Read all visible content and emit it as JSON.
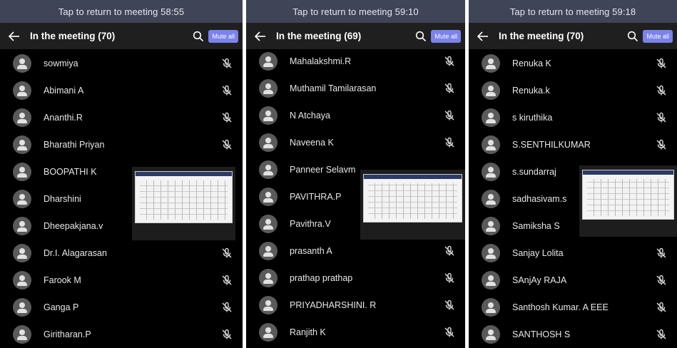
{
  "panels": [
    {
      "banner": "Tap to return to meeting 58:55",
      "title": "In the meeting (70)",
      "mute_all": "Mute all",
      "participants": [
        "sowmiya",
        "Abimani A",
        "Ananthi.R",
        "Bharathi Priyan",
        "BOOPATHI K",
        "Dharshini",
        "Dheepakjana.v",
        "Dr.I. Alagarasan",
        "Farook M",
        "Ganga P",
        "Giritharan.P"
      ]
    },
    {
      "banner": "Tap to return to meeting 59:10",
      "title": "In the meeting (69)",
      "mute_all": "Mute all",
      "participants": [
        "Mahalakshmi.R",
        "Muthamil Tamilarasan",
        "N Atchaya",
        "Naveena K",
        "Panneer Selavm",
        "PAVITHRA.P",
        "Pavithra.V",
        "prasanth A",
        "prathap prathap",
        "PRIYADHARSHINI. R",
        "Ranjith K"
      ]
    },
    {
      "banner": "Tap to return to meeting 59:18",
      "title": "In the meeting (70)",
      "mute_all": "Mute all",
      "participants": [
        "Renuka K",
        "Renuka.k",
        "s kiruthika",
        "S.SENTHILKUMAR",
        "s.sundarraj",
        "sadhasivam.s",
        "Samiksha S",
        "Sanjay Lolita",
        "SAnjAy RAJA",
        "Santhosh Kumar. A EEE",
        "SANTHOSH S"
      ]
    }
  ],
  "icons": {
    "back": "arrow-left-icon",
    "search": "search-icon",
    "mic": "mic-off-icon",
    "avatar": "person-icon"
  },
  "colors": {
    "banner_bg": "#3f4457",
    "header_bg": "#1f1f1f",
    "list_bg": "#000000",
    "mute_all_bg": "#7b83eb"
  }
}
